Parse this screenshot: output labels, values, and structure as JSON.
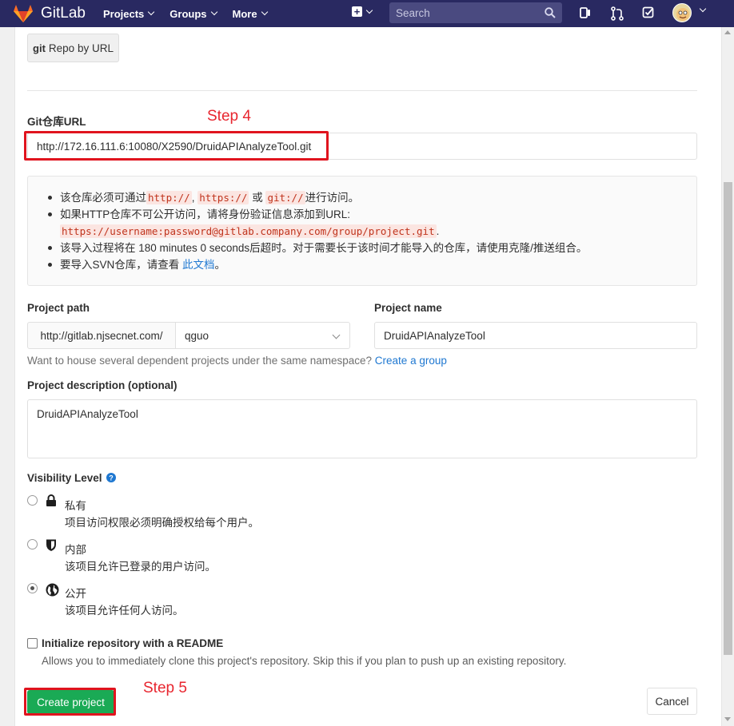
{
  "navbar": {
    "brand": "GitLab",
    "menu": [
      {
        "label": "Projects"
      },
      {
        "label": "Groups"
      },
      {
        "label": "More"
      }
    ],
    "search_placeholder": "Search",
    "colors": {
      "background": "#292961",
      "logo": "#e24329"
    }
  },
  "import": {
    "repo_button_prefix": "git",
    "repo_button_label": "Repo by URL",
    "git_url_label": "Git仓库URL",
    "git_url_value": "http://172.16.111.6:10080/X2590/DruidAPIAnalyzeTool.git",
    "notes": {
      "line1_a": "该仓库必须可通过",
      "line1_code1": "http://",
      "line1_sep": ",",
      "line1_code2": "https://",
      "line1_or": " 或 ",
      "line1_code3": "git://",
      "line1_b": "进行访问。",
      "line2": "如果HTTP仓库不可公开访问，请将身份验证信息添加到URL:",
      "line2_code": "https://username:password@gitlab.company.com/group/project.git",
      "line2_end": ".",
      "line3": "该导入过程将在 180 minutes 0 seconds后超时。对于需要长于该时间才能导入的仓库，请使用克隆/推送组合。",
      "line4_a": "要导入SVN仓库，请查看 ",
      "line4_link": "此文档",
      "line4_b": "。"
    }
  },
  "annotations": {
    "step4": "Step 4",
    "step5": "Step 5",
    "color": "#e0141e"
  },
  "project": {
    "path_label": "Project path",
    "path_prefix": "http://gitlab.njsecnet.com/",
    "namespace": "qguo",
    "name_label": "Project name",
    "name_value": "DruidAPIAnalyzeTool",
    "help_text": "Want to house several dependent projects under the same namespace?",
    "help_link": "Create a group",
    "description_label": "Project description (optional)",
    "description_value": "DruidAPIAnalyzeTool"
  },
  "visibility": {
    "label": "Visibility Level",
    "options": [
      {
        "title": "私有",
        "desc": "项目访问权限必须明确授权给每个用户。",
        "icon": "lock-icon",
        "selected": false
      },
      {
        "title": "内部",
        "desc": "该项目允许已登录的用户访问。",
        "icon": "shield-icon",
        "selected": false
      },
      {
        "title": "公开",
        "desc": "该项目允许任何人访问。",
        "icon": "globe-icon",
        "selected": true
      }
    ]
  },
  "readme": {
    "label": "Initialize repository with a README",
    "help": "Allows you to immediately clone this project's repository. Skip this if you plan to push up an existing repository.",
    "checked": false
  },
  "actions": {
    "create": "Create project",
    "cancel": "Cancel",
    "create_color": "#1aaa55"
  }
}
